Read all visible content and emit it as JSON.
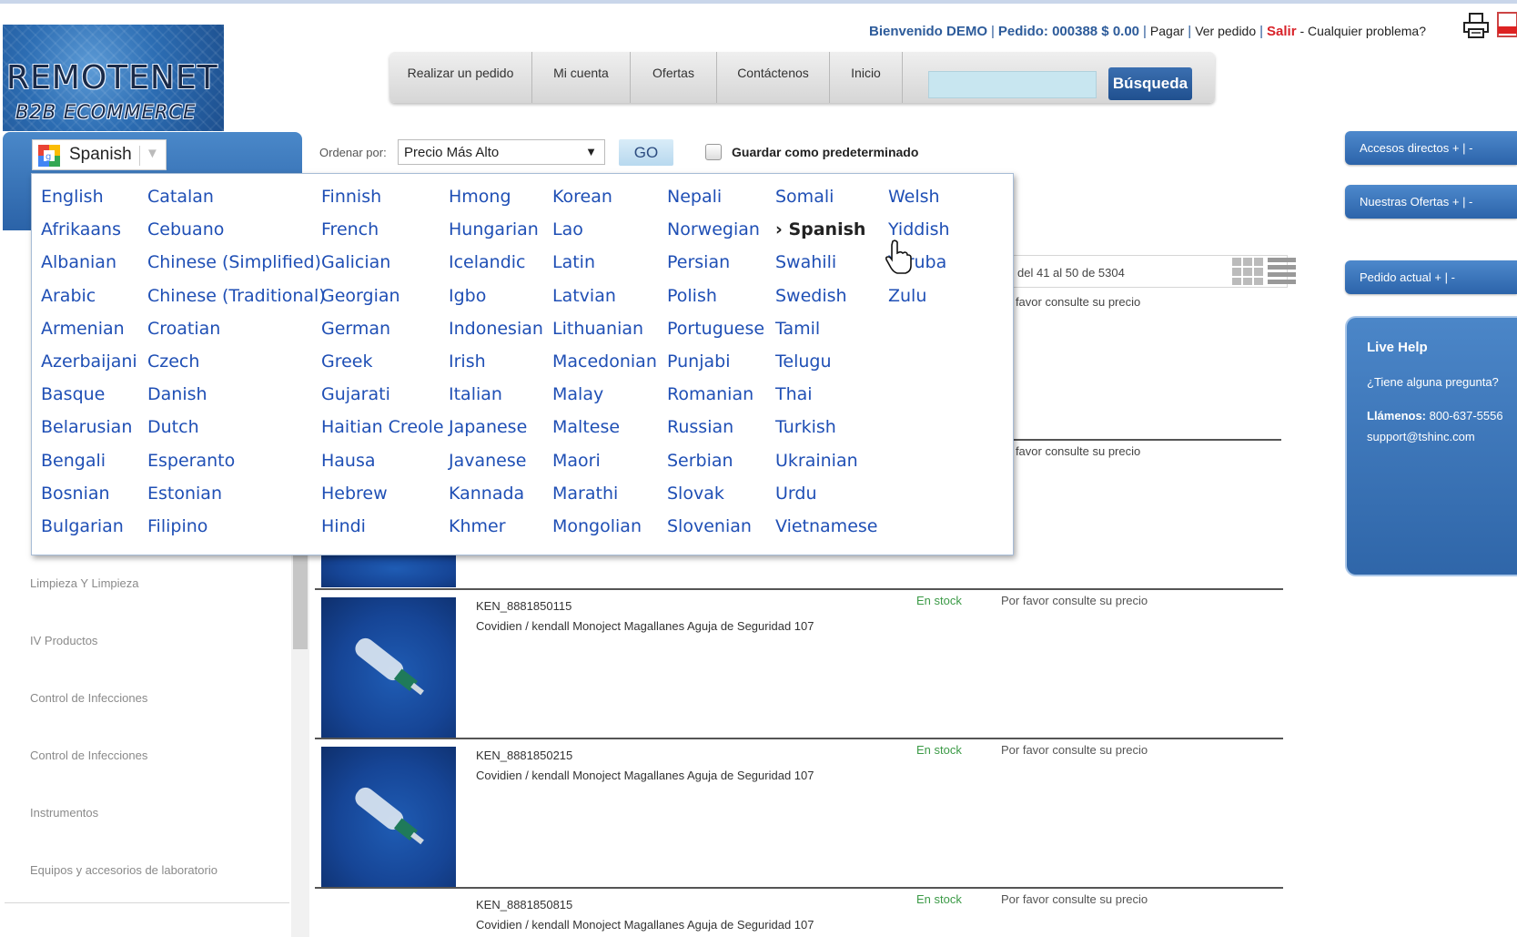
{
  "logo": {
    "line1": "REMOTENET",
    "line2": "B2B ECOMMERCE"
  },
  "header": {
    "welcome": "Bienvenido DEMO",
    "order": "Pedido: 000388 $ 0.00",
    "pay": "Pagar",
    "view_order": "Ver pedido",
    "logout": "Salir",
    "problem": "Cualquier problema?"
  },
  "nav": {
    "items": [
      {
        "label": "Realizar un pedido"
      },
      {
        "label": "Mi cuenta"
      },
      {
        "label": "Ofertas"
      },
      {
        "label": "Contáctenos"
      },
      {
        "label": "Inicio"
      }
    ],
    "search_value": "",
    "search_label": "Búsqueda"
  },
  "language_selector": {
    "selected": "Spanish"
  },
  "sort": {
    "label": "Ordenar por:",
    "selected": "Precio Más Alto",
    "go_label": "GO",
    "save_default_label": "Guardar como predeterminado",
    "save_default_checked": false
  },
  "languages": [
    [
      "English",
      "Afrikaans",
      "Albanian",
      "Arabic",
      "Armenian",
      "Azerbaijani",
      "Basque",
      "Belarusian",
      "Bengali",
      "Bosnian",
      "Bulgarian"
    ],
    [
      "Catalan",
      "Cebuano",
      "Chinese (Simplified)",
      "Chinese (Traditional)",
      "Croatian",
      "Czech",
      "Danish",
      "Dutch",
      "Esperanto",
      "Estonian",
      "Filipino"
    ],
    [
      "Finnish",
      "French",
      "Galician",
      "Georgian",
      "German",
      "Greek",
      "Gujarati",
      "Haitian Creole",
      "Hausa",
      "Hebrew",
      "Hindi"
    ],
    [
      "Hmong",
      "Hungarian",
      "Icelandic",
      "Igbo",
      "Indonesian",
      "Irish",
      "Italian",
      "Japanese",
      "Javanese",
      "Kannada",
      "Khmer"
    ],
    [
      "Korean",
      "Lao",
      "Latin",
      "Latvian",
      "Lithuanian",
      "Macedonian",
      "Malay",
      "Maltese",
      "Maori",
      "Marathi",
      "Mongolian"
    ],
    [
      "Nepali",
      "Norwegian",
      "Persian",
      "Polish",
      "Portuguese",
      "Punjabi",
      "Romanian",
      "Russian",
      "Serbian",
      "Slovak",
      "Slovenian"
    ],
    [
      "Somali",
      "› Spanish",
      "Swahili",
      "Swedish",
      "Tamil",
      "Telugu",
      "Thai",
      "Turkish",
      "Ukrainian",
      "Urdu",
      "Vietnamese"
    ],
    [
      "Welsh",
      "Yiddish",
      "Yoruba",
      "Zulu"
    ]
  ],
  "sidebar": {
    "categories": [
      "Limpieza Y Limpieza",
      "IV Productos",
      "Control de Infecciones",
      "Control de Infecciones",
      "Instrumentos",
      "Equipos y accesorios de laboratorio"
    ]
  },
  "listing": {
    "range": "del 41 al 50 de 5304",
    "partial_price_1": "r favor consulte su precio",
    "partial_price_2": "r favor consulte su precio",
    "products": [
      {
        "code": "KEN_8881850115",
        "name": "Covidien / kendall Monoject Magallanes Aguja de Seguridad 107",
        "stock": "En stock",
        "price": "Por favor consulte su precio"
      },
      {
        "code": "KEN_8881850215",
        "name": "Covidien / kendall Monoject Magallanes Aguja de Seguridad 107",
        "stock": "En stock",
        "price": "Por favor consulte su precio"
      },
      {
        "code": "KEN_8881850815",
        "name": "Covidien / kendall Monoject Magallanes Aguja de Seguridad 107",
        "stock": "En stock",
        "price": "Por favor consulte su precio"
      }
    ]
  },
  "right_panel": {
    "shortcuts": "Accesos directos + | -",
    "offers": "Nuestras Ofertas + | -",
    "current_order": "Pedido actual + | -",
    "live_help": {
      "title": "Live Help",
      "question": "¿Tiene alguna pregunta?",
      "call_label": "Llámenos:",
      "phone": "800-637-5556",
      "email": "support@tshinc.com"
    }
  },
  "colors": {
    "brand_blue": "#2c64aa",
    "link_blue": "#1f4fb5",
    "logout_red": "#d8232a",
    "stock_green": "#3b9a46"
  }
}
